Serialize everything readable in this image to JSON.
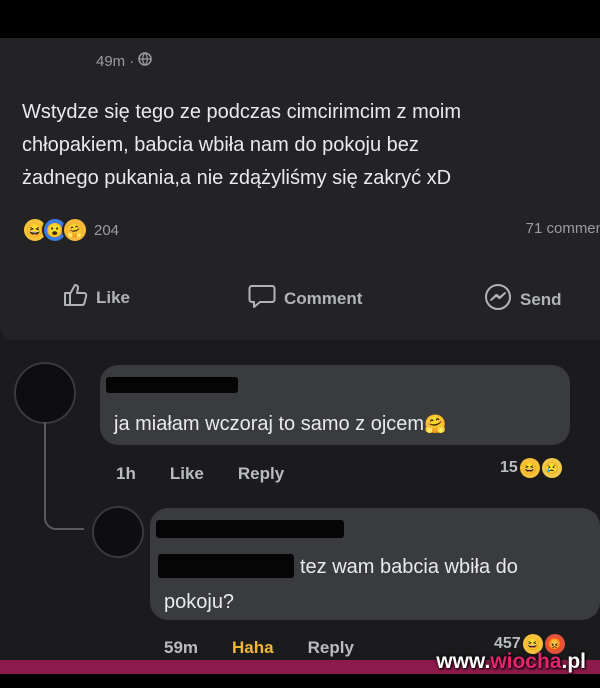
{
  "post": {
    "time": "49m",
    "separator": "·",
    "privacy_icon": "globe-icon",
    "lines": [
      "Wstydze się tego ze podczas cimcirimcim z moim",
      "chłopakiem, babcia wbiła nam do pokoju bez",
      "żadnego pukania,a nie zdążyliśmy się zakryć xD"
    ],
    "reaction_count": "204",
    "reaction_icons": [
      "laugh-reaction",
      "wow-reaction",
      "care-reaction"
    ],
    "comment_count": "71 commen",
    "actions": {
      "like": "Like",
      "comment": "Comment",
      "send": "Send"
    }
  },
  "comments": [
    {
      "text": "ja miałam wczoraj to samo z ojcem",
      "time": "1h",
      "like": "Like",
      "reply": "Reply",
      "reactions_count": "15"
    },
    {
      "text_line1": "tez wam babcia wbiła do",
      "text_line2": "pokoju?",
      "time": "59m",
      "reaction_label": "Haha",
      "reply": "Reply",
      "reactions_count": "457"
    }
  ],
  "watermark": {
    "prefix": "www.",
    "brand": "wiocha",
    "suffix": ".pl"
  },
  "colors": {
    "background": "#1b1b1d",
    "haha": "#f2b636",
    "watermark_accent": "#e2256d"
  }
}
